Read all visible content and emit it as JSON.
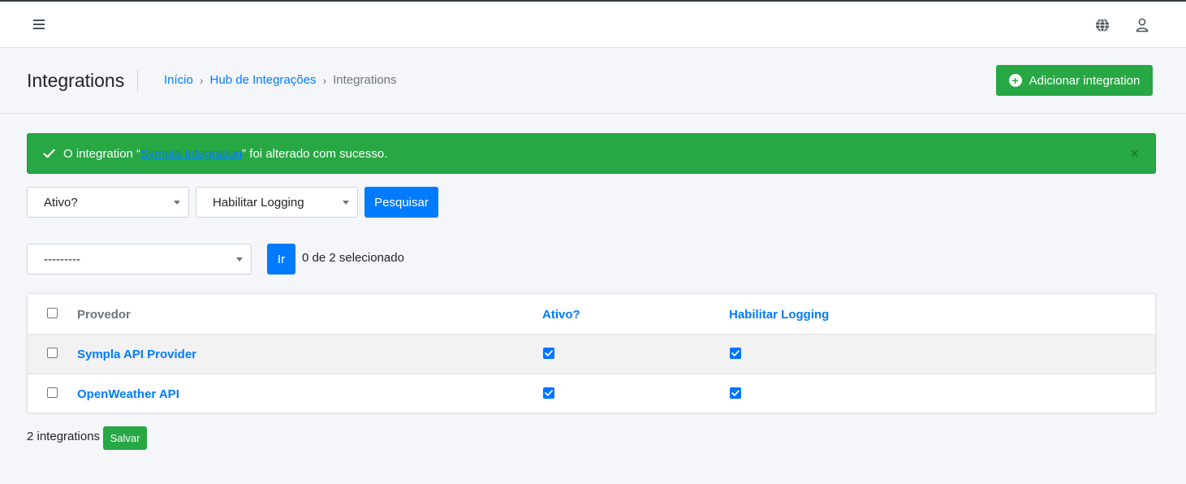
{
  "colors": {
    "primary": "#007bff",
    "success": "#28a745",
    "background": "#f4f6f9"
  },
  "navbar": {
    "menu_icon": "hamburger-menu-icon",
    "language_icon": "globe-icon",
    "user_icon": "user-icon"
  },
  "header": {
    "title": "Integrations",
    "breadcrumb": [
      {
        "label": "Início",
        "link": true
      },
      {
        "label": "Hub de Integrações",
        "link": true
      },
      {
        "label": "Integrations",
        "link": false
      }
    ],
    "separator": "›",
    "add_button_label": "Adicionar integration",
    "add_button_icon": "plus-circle-icon"
  },
  "alert": {
    "icon": "check-icon",
    "text_before": "O integration “",
    "link_text": "Sympla Integration",
    "text_after": "” foi alterado com sucesso.",
    "close_label": "×"
  },
  "filters": {
    "ativo_selected": "Ativo?",
    "logging_selected": "Habilitar Logging",
    "search_button": "Pesquisar"
  },
  "actions": {
    "action_selected": "---------",
    "go_button": "Ir",
    "selection_counter": "0 de 2 selecionado"
  },
  "table": {
    "columns": [
      "Provedor",
      "Ativo?",
      "Habilitar Logging"
    ],
    "rows": [
      {
        "provedor": "Sympla API Provider",
        "ativo": true,
        "habilitar_logging": true,
        "selected": false
      },
      {
        "provedor": "OpenWeather API",
        "ativo": true,
        "habilitar_logging": true,
        "selected": false
      }
    ]
  },
  "footer": {
    "count_text": "2 integrations",
    "save_button": "Salvar"
  }
}
